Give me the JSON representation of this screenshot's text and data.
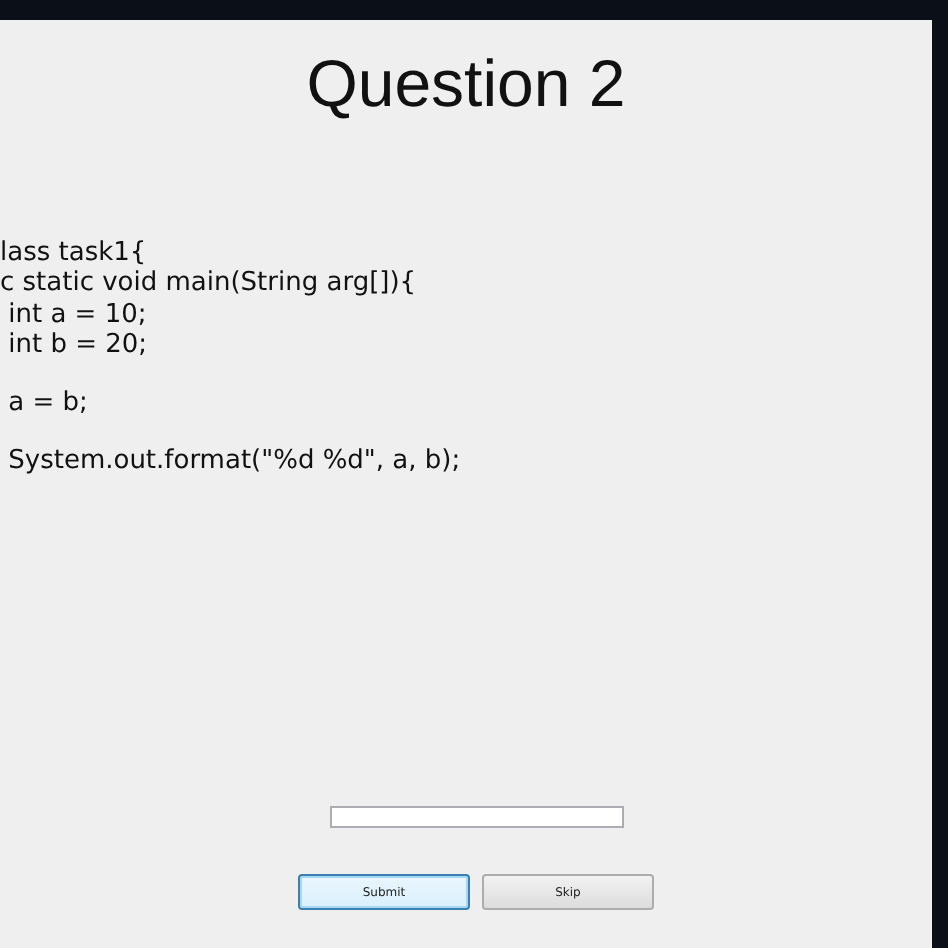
{
  "title": "Question 2",
  "code_blocks": [
    [
      "lass task1{",
      "c static void main(String arg[]){",
      " int a = 10;",
      " int b = 20;"
    ],
    [
      " a = b;"
    ],
    [
      " System.out.format(\"%d %d\", a, b);"
    ]
  ],
  "buttons": [
    {
      "label": "Submit",
      "focused": true
    },
    {
      "label": "Skip",
      "focused": false
    }
  ]
}
